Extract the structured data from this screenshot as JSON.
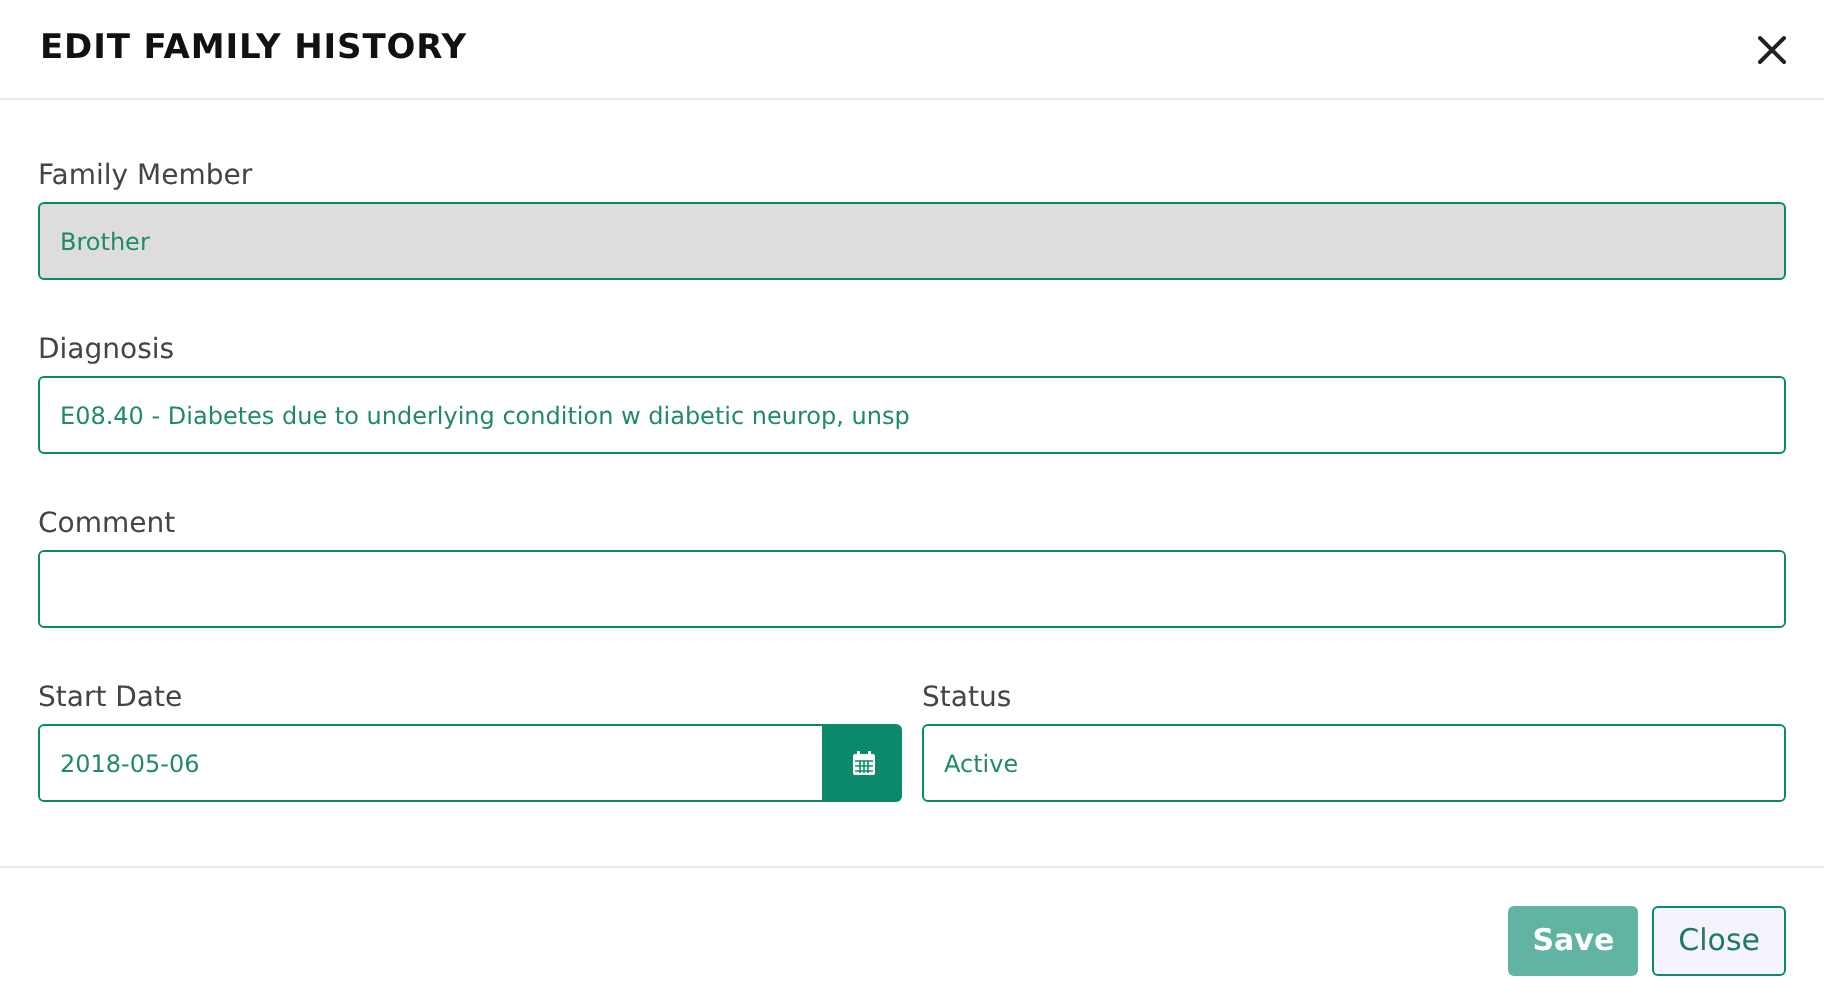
{
  "dialog": {
    "title": "EDIT FAMILY HISTORY"
  },
  "fields": [
    {
      "kind": "text",
      "label": "Family Member",
      "value": "Brother",
      "disabled": true
    },
    {
      "kind": "text",
      "label": "Diagnosis",
      "value": "E08.40 - Diabetes due to underlying condition w diabetic neurop, unsp",
      "disabled": false
    },
    {
      "kind": "text",
      "label": "Comment",
      "disabled": false
    }
  ],
  "row_fields": [
    {
      "kind": "date",
      "label": "Start Date",
      "value": "2018-05-06",
      "disabled": false
    },
    {
      "kind": "text",
      "label": "Status",
      "value": "Active",
      "disabled": false
    }
  ],
  "buttons": [
    {
      "kind": "primary",
      "label": "Save",
      "disabled": true
    },
    {
      "kind": "secondary",
      "label": "Close",
      "disabled": false
    }
  ]
}
